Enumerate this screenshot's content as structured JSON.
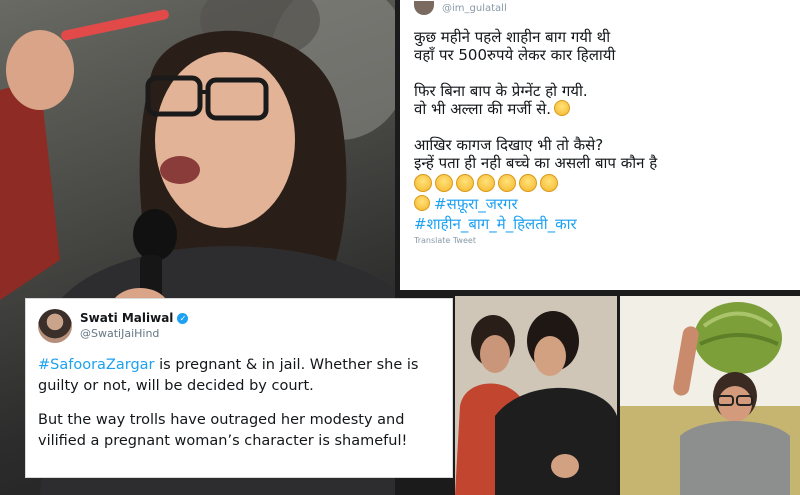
{
  "top_tweet": {
    "handle": "@im_gulatall",
    "lines": [
      "कुछ महीने पहले शाहीन बाग गयी थी",
      "वहाँ पर 500रुपये लेकर कार हिलायी",
      "",
      "फिर बिना बाप के प्रेग्नेंट हो गयी.",
      "वो भी अल्ला की मर्जी से.",
      "",
      "आखिर कागज दिखाए भी तो कैसे?",
      "इन्हें पता ही नही बच्चे का असली बाप कौन है"
    ],
    "emoji_count": 7,
    "hashtag_1": "#सफ़ूरा_जरगर",
    "hashtag_2": "#शाहीन_बाग_मे_हिलती_कार",
    "translate_label": "Translate Tweet"
  },
  "swati_tweet": {
    "name": "Swati Maliwal",
    "handle": "@SwatiJaiHind",
    "mention": "#SafooraZargar",
    "para1_rest": " is pregnant & in jail. Whether she is guilty or not, will be decided by court.",
    "para2": "But the way trolls have outraged her modesty and vilified a pregnant woman’s character is shameful!"
  }
}
